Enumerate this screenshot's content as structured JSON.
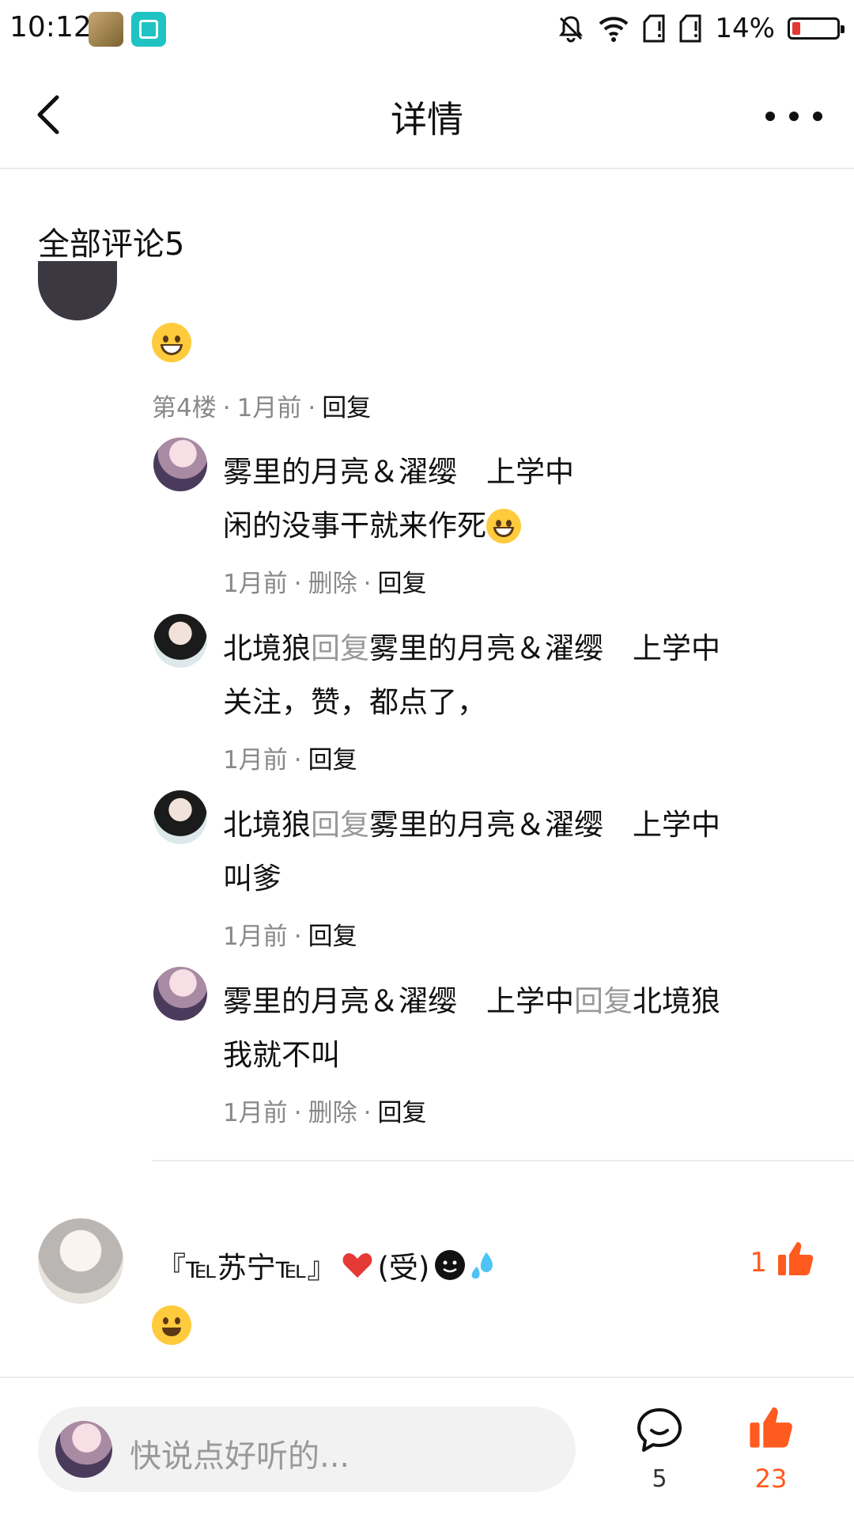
{
  "status_bar": {
    "time": "10:12",
    "battery": "14%",
    "icons": [
      "bell-off-icon",
      "wifi-icon",
      "sim1-icon",
      "sim2-icon",
      "battery-icon"
    ]
  },
  "nav": {
    "title": "详情",
    "back_icon": "chevron-left-icon",
    "more_icon": "more-dots-icon"
  },
  "section_title": "全部评论5",
  "comment4": {
    "meta": {
      "floor": "第4楼",
      "time": "1月前",
      "reply": "回复"
    },
    "replies": [
      {
        "user": "雾里的月亮＆濯缨　上学中",
        "text": "闲的没事干就来作死",
        "time": "1月前",
        "delete": "删除",
        "reply": "回复"
      },
      {
        "user": "北境狼",
        "reply_word": "回复",
        "target": "雾里的月亮＆濯缨　上学中",
        "text": "关注，赞，都点了，",
        "time": "1月前",
        "reply": "回复"
      },
      {
        "user": "北境狼",
        "reply_word": "回复",
        "target": "雾里的月亮＆濯缨　上学中",
        "text": "叫爹",
        "time": "1月前",
        "reply": "回复"
      },
      {
        "user": "雾里的月亮＆濯缨　上学中",
        "reply_word": "回复",
        "target": "北境狼",
        "text": "我就不叫",
        "time": "1月前",
        "delete": "删除",
        "reply": "回复"
      }
    ]
  },
  "comment5": {
    "user": "『℡苏宁℡』",
    "user_suffix": "(受)",
    "likes": "1"
  },
  "bottom_bar": {
    "placeholder": "快说点好听的...",
    "comment_count": "5",
    "like_count": "23"
  },
  "colors": {
    "accent": "#ff5a1f",
    "muted": "#999999"
  }
}
